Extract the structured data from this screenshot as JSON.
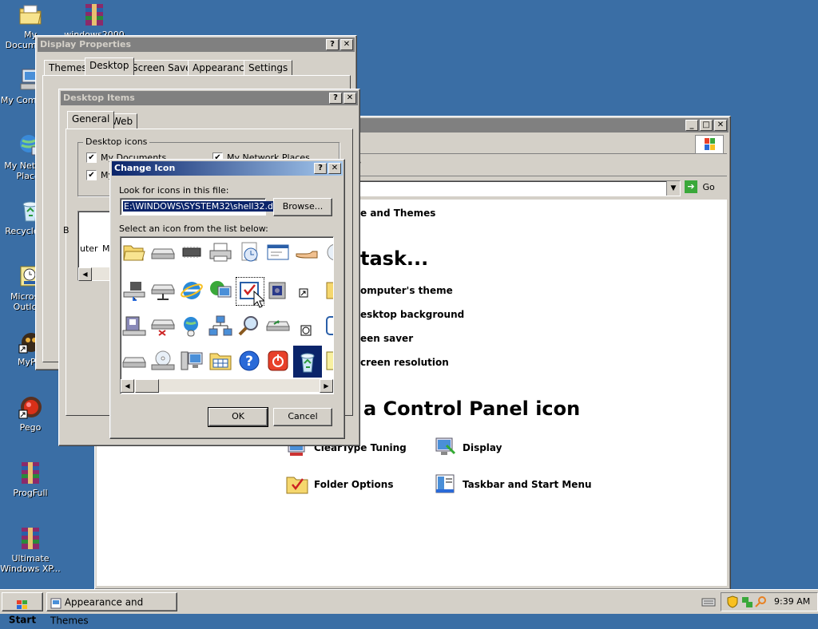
{
  "desktop": {
    "icons": [
      {
        "label": "My Documents"
      },
      {
        "label": "windows2000"
      },
      {
        "label": "My Computer"
      },
      {
        "label": "My Network Places"
      },
      {
        "label": "Recycle Bin"
      },
      {
        "label": "Microsoft Outlook"
      },
      {
        "label": "MyPal"
      },
      {
        "label": "Pego"
      },
      {
        "label": "ProgFull"
      },
      {
        "label": "Ultimate Windows XP..."
      }
    ]
  },
  "control_panel": {
    "go_label": "Go",
    "breadcrumb": "e and Themes",
    "pick_task": "task...",
    "tasks": [
      "omputer's theme",
      "esktop background",
      "een saver",
      "creen resolution"
    ],
    "pick_icon": "a Control Panel icon",
    "items": [
      "ClearType Tuning",
      "Display",
      "Folder Options",
      "Taskbar and Start Menu"
    ]
  },
  "display_properties": {
    "title": "Display Properties",
    "tabs": [
      "Themes",
      "Desktop",
      "Screen Saver",
      "Appearance",
      "Settings"
    ]
  },
  "desktop_items": {
    "title": "Desktop Items",
    "tabs": [
      "General",
      "Web"
    ],
    "group_label": "Desktop icons",
    "checks": [
      "My Documents",
      "My Network Places",
      "My"
    ],
    "partial_b": "B",
    "list_items": [
      "uter",
      "M"
    ]
  },
  "change_icon": {
    "title": "Change Icon",
    "look_label": "Look for icons in this file:",
    "file_value": "E:\\WINDOWS\\SYSTEM32\\shell32.dll",
    "browse_label": "Browse...",
    "select_label": "Select an icon from the list below:",
    "ok_label": "OK",
    "cancel_label": "Cancel"
  },
  "taskbar": {
    "start_label": "Start",
    "task_label": "Appearance and Themes",
    "clock": "9:39 AM"
  },
  "colors": {
    "desktop": "#3a6ea5",
    "active_title": "#0a246a",
    "face": "#d4d0c8"
  }
}
